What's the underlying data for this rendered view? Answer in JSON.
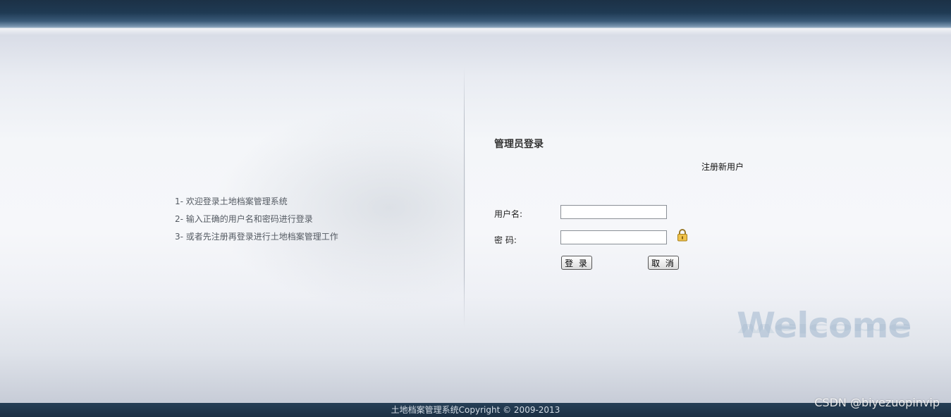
{
  "instructions": [
    "1- 欢迎登录土地档案管理系统",
    "2- 输入正确的用户名和密码进行登录",
    "3- 或者先注册再登录进行土地档案管理工作"
  ],
  "login": {
    "title": "管理员登录",
    "register_link": "注册新用户",
    "username_label": "用户名:",
    "password_label": "密 码:",
    "username_value": "",
    "password_value": "",
    "login_button": "登 录",
    "cancel_button": "取 消",
    "lock_icon": "lock-icon"
  },
  "decor": {
    "welcome_text": "Welcome"
  },
  "footer": {
    "text": "土地档案管理系统Copyright © 2009-2013"
  },
  "watermark": "CSDN @biyezuopinvip",
  "colors": {
    "header_dark": "#1c3146",
    "footer_bg": "#1c3044",
    "welcome": "#a0b6cd"
  }
}
